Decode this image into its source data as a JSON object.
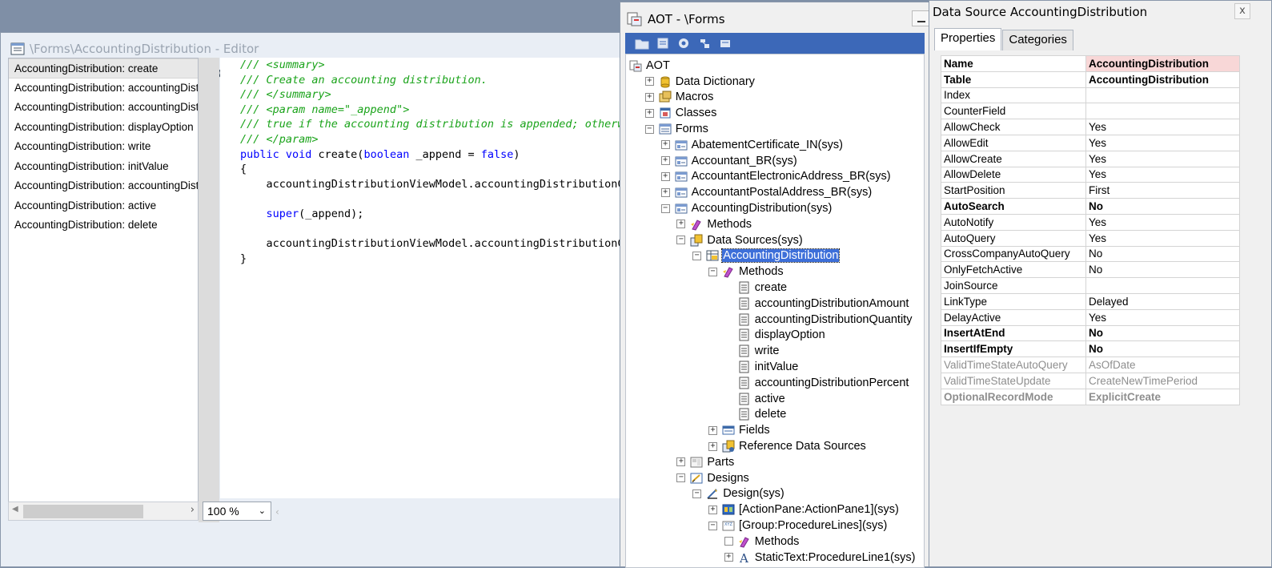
{
  "editor": {
    "title": "\\Forms\\AccountingDistribution - Editor",
    "methods": [
      "AccountingDistribution: create",
      "AccountingDistribution: accountingDistributionAmount",
      "AccountingDistribution: accountingDistributionQuantity",
      "AccountingDistribution: displayOption",
      "AccountingDistribution: write",
      "AccountingDistribution: initValue",
      "AccountingDistribution: accountingDistributionPercent",
      "AccountingDistribution: active",
      "AccountingDistribution: delete"
    ],
    "code": [
      [
        {
          "t": "/// <summary>",
          "c": "cm"
        }
      ],
      [
        {
          "t": "/// Create an accounting distribution.",
          "c": "cm"
        }
      ],
      [
        {
          "t": "/// </summary>",
          "c": "cm"
        }
      ],
      [
        {
          "t": "/// <param name=\"_append\">",
          "c": "cm"
        }
      ],
      [
        {
          "t": "/// true if the accounting distribution is appended; otherwise",
          "c": "cm"
        }
      ],
      [
        {
          "t": "/// </param>",
          "c": "cm"
        }
      ],
      [
        {
          "t": "public void",
          "c": "kw"
        },
        {
          "t": " create(",
          "c": ""
        },
        {
          "t": "boolean",
          "c": "kw"
        },
        {
          "t": " _append = ",
          "c": ""
        },
        {
          "t": "false",
          "c": "kw"
        },
        {
          "t": ")",
          "c": ""
        }
      ],
      [
        {
          "t": "{",
          "c": ""
        }
      ],
      [
        {
          "t": "    accountingDistributionViewModel.accountingDistributionCr",
          "c": ""
        }
      ],
      [
        {
          "t": "",
          "c": ""
        }
      ],
      [
        {
          "t": "    ",
          "c": ""
        },
        {
          "t": "super",
          "c": "kw"
        },
        {
          "t": "(_append);",
          "c": ""
        }
      ],
      [
        {
          "t": "",
          "c": ""
        }
      ],
      [
        {
          "t": "    accountingDistributionViewModel.accountingDistributionCr",
          "c": ""
        }
      ],
      [
        {
          "t": "}",
          "c": ""
        }
      ]
    ],
    "zoom": "100 %"
  },
  "aot": {
    "title": "AOT - \\Forms",
    "tree": [
      {
        "label": "AOT",
        "level": 0,
        "exp": "",
        "icon": "aot"
      },
      {
        "label": "Data Dictionary",
        "level": 1,
        "exp": "+",
        "icon": "db"
      },
      {
        "label": "Macros",
        "level": 1,
        "exp": "+",
        "icon": "macro"
      },
      {
        "label": "Classes",
        "level": 1,
        "exp": "+",
        "icon": "classes"
      },
      {
        "label": "Forms",
        "level": 1,
        "exp": "-",
        "icon": "forms"
      },
      {
        "label": "AbatementCertificate_IN(sys)",
        "level": 2,
        "exp": "+",
        "icon": "form"
      },
      {
        "label": "Accountant_BR(sys)",
        "level": 2,
        "exp": "+",
        "icon": "form"
      },
      {
        "label": "AccountantElectronicAddress_BR(sys)",
        "level": 2,
        "exp": "+",
        "icon": "form"
      },
      {
        "label": "AccountantPostalAddress_BR(sys)",
        "level": 2,
        "exp": "+",
        "icon": "form"
      },
      {
        "label": "AccountingDistribution(sys)",
        "level": 2,
        "exp": "-",
        "icon": "form"
      },
      {
        "label": "Methods",
        "level": 3,
        "exp": "+",
        "icon": "methods"
      },
      {
        "label": "Data Sources(sys)",
        "level": 3,
        "exp": "-",
        "icon": "datasources"
      },
      {
        "label": "AccountingDistribution",
        "level": 4,
        "exp": "-",
        "icon": "datasource",
        "selected": true
      },
      {
        "label": "Methods",
        "level": 5,
        "exp": "-",
        "icon": "methods"
      },
      {
        "label": "create",
        "level": 6,
        "exp": "",
        "icon": "method"
      },
      {
        "label": "accountingDistributionAmount",
        "level": 6,
        "exp": "",
        "icon": "method"
      },
      {
        "label": "accountingDistributionQuantity",
        "level": 6,
        "exp": "",
        "icon": "method"
      },
      {
        "label": "displayOption",
        "level": 6,
        "exp": "",
        "icon": "method"
      },
      {
        "label": "write",
        "level": 6,
        "exp": "",
        "icon": "method"
      },
      {
        "label": "initValue",
        "level": 6,
        "exp": "",
        "icon": "method"
      },
      {
        "label": "accountingDistributionPercent",
        "level": 6,
        "exp": "",
        "icon": "method"
      },
      {
        "label": "active",
        "level": 6,
        "exp": "",
        "icon": "method"
      },
      {
        "label": "delete",
        "level": 6,
        "exp": "",
        "icon": "method"
      },
      {
        "label": "Fields",
        "level": 5,
        "exp": "+",
        "icon": "fields"
      },
      {
        "label": "Reference Data Sources",
        "level": 5,
        "exp": "+",
        "icon": "refds"
      },
      {
        "label": "Parts",
        "level": 3,
        "exp": "+",
        "icon": "parts"
      },
      {
        "label": "Designs",
        "level": 3,
        "exp": "-",
        "icon": "designs"
      },
      {
        "label": "Design(sys)",
        "level": 4,
        "exp": "-",
        "icon": "design"
      },
      {
        "label": "[ActionPane:ActionPane1](sys)",
        "level": 5,
        "exp": "+",
        "icon": "actionpane"
      },
      {
        "label": "[Group:ProcedureLines](sys)",
        "level": 5,
        "exp": "-",
        "icon": "group"
      },
      {
        "label": "Methods",
        "level": 6,
        "exp": "box",
        "icon": "methods"
      },
      {
        "label": "StaticText:ProcedureLine1(sys)",
        "level": 6,
        "exp": "+",
        "icon": "statictext"
      }
    ]
  },
  "props": {
    "title": "Data Source AccountingDistribution",
    "close": "x",
    "tabs": [
      "Properties",
      "Categories"
    ],
    "rows": [
      {
        "k": "Name",
        "v": "AccountingDistribution",
        "style": "bold hl"
      },
      {
        "k": "Table",
        "v": "AccountingDistribution",
        "style": "bold"
      },
      {
        "k": "Index",
        "v": "",
        "style": ""
      },
      {
        "k": "CounterField",
        "v": "",
        "style": ""
      },
      {
        "k": "AllowCheck",
        "v": "Yes",
        "style": ""
      },
      {
        "k": "AllowEdit",
        "v": "Yes",
        "style": ""
      },
      {
        "k": "AllowCreate",
        "v": "Yes",
        "style": ""
      },
      {
        "k": "AllowDelete",
        "v": "Yes",
        "style": ""
      },
      {
        "k": "StartPosition",
        "v": "First",
        "style": ""
      },
      {
        "k": "AutoSearch",
        "v": "No",
        "style": "bold"
      },
      {
        "k": "AutoNotify",
        "v": "Yes",
        "style": ""
      },
      {
        "k": "AutoQuery",
        "v": "Yes",
        "style": ""
      },
      {
        "k": "CrossCompanyAutoQuery",
        "v": "No",
        "style": ""
      },
      {
        "k": "OnlyFetchActive",
        "v": "No",
        "style": ""
      },
      {
        "k": "JoinSource",
        "v": "",
        "style": ""
      },
      {
        "k": "LinkType",
        "v": "Delayed",
        "style": ""
      },
      {
        "k": "DelayActive",
        "v": "Yes",
        "style": ""
      },
      {
        "k": "InsertAtEnd",
        "v": "No",
        "style": "bold"
      },
      {
        "k": "InsertIfEmpty",
        "v": "No",
        "style": "bold"
      },
      {
        "k": "ValidTimeStateAutoQuery",
        "v": "AsOfDate",
        "style": "dis"
      },
      {
        "k": "ValidTimeStateUpdate",
        "v": "CreateNewTimePeriod",
        "style": "dis"
      },
      {
        "k": "OptionalRecordMode",
        "v": "ExplicitCreate",
        "style": "bold dis"
      }
    ]
  }
}
